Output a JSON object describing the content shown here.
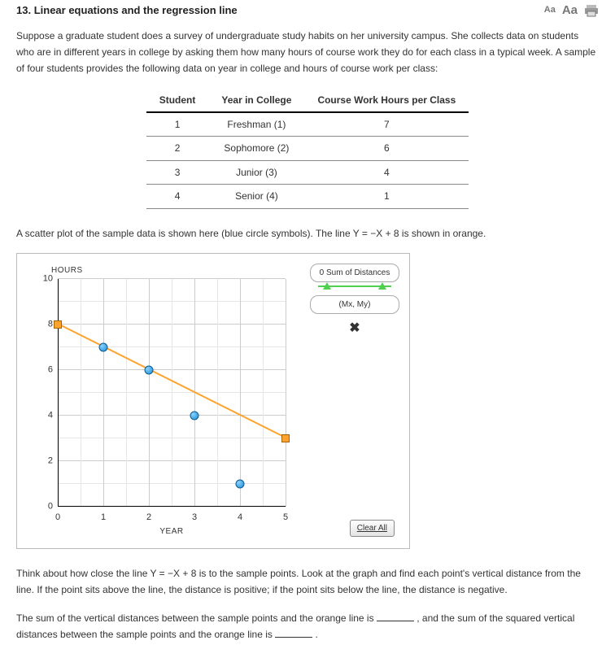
{
  "header": {
    "number": "13.",
    "title": "Linear equations and the regression line",
    "font_small": "Aa",
    "font_large": "Aa"
  },
  "intro": "Suppose a graduate student does a survey of undergraduate study habits on her university campus. She collects data on students who are in different years in college by asking them how many hours of course work they do for each class in a typical week. A sample of four students provides the following data on year in college and hours of course work per class:",
  "table": {
    "headers": [
      "Student",
      "Year in College",
      "Course Work Hours per Class"
    ],
    "rows": [
      [
        "1",
        "Freshman (1)",
        "7"
      ],
      [
        "2",
        "Sophomore (2)",
        "6"
      ],
      [
        "3",
        "Junior (3)",
        "4"
      ],
      [
        "4",
        "Senior (4)",
        "1"
      ]
    ]
  },
  "scatter_caption": "A scatter plot of the sample data is shown here (blue circle symbols). The line Y = −X + 8 is shown in orange.",
  "chart_data": {
    "type": "scatter",
    "title": "HOURS",
    "xlabel": "YEAR",
    "ylabel": "",
    "xlim": [
      0,
      5
    ],
    "ylim": [
      0,
      10
    ],
    "x_ticks": [
      0,
      1,
      2,
      3,
      4,
      5
    ],
    "y_ticks": [
      0,
      2,
      4,
      6,
      8,
      10
    ],
    "points": [
      {
        "x": 1,
        "y": 7
      },
      {
        "x": 2,
        "y": 6
      },
      {
        "x": 3,
        "y": 4
      },
      {
        "x": 4,
        "y": 1
      }
    ],
    "line": {
      "x1": 0,
      "y1": 8,
      "x2": 5,
      "y2": 3,
      "equation": "Y = -X + 8"
    },
    "legend": {
      "sum_label": "0 Sum of Distances",
      "mean_label": "(Mx, My)"
    },
    "clear_label": "Clear All"
  },
  "para2": "Think about how close the line Y = −X + 8 is to the sample points. Look at the graph and find each point's vertical distance from the line. If the point sits above the line, the distance is positive; if the point sits below the line, the distance is negative.",
  "para3_a": "The sum of the vertical distances between the sample points and the orange line is ",
  "para3_b": " , and the sum of the squared vertical distances between the sample points and the orange line is ",
  "para3_c": " ."
}
